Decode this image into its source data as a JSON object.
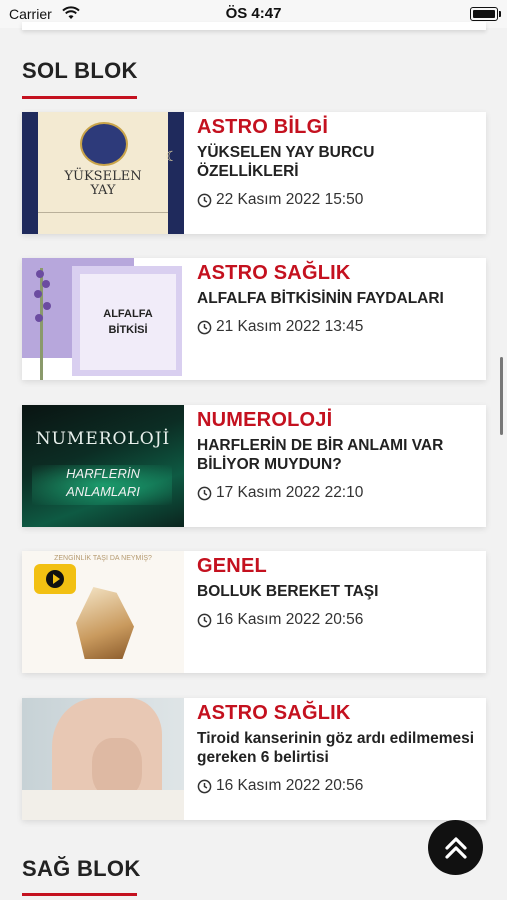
{
  "status_bar": {
    "carrier": "Carrier",
    "time": "ÖS 4:47"
  },
  "sections": {
    "left_title": "SOL BLOK",
    "right_title": "SAĞ BLOK",
    "accent_color": "#c4111f"
  },
  "articles": [
    {
      "category": "ASTRO BİLGİ",
      "title": "YÜKSELEN YAY BURCU ÖZELLİKLERİ",
      "date": "22 Kasım 2022 15:50",
      "thumb_text": [
        "YÜKSELEN",
        "YAY"
      ]
    },
    {
      "category": "ASTRO SAĞLIK",
      "title": "ALFALFA BİTKİSİNİN FAYDALARI",
      "date": "21 Kasım 2022 13:45",
      "thumb_text": [
        "ALFALFA",
        "BİTKİSİ"
      ]
    },
    {
      "category": "NUMEROLOJİ",
      "title": "HARFLERİN DE BİR ANLAMI VAR BİLİYOR MUYDUN?",
      "date": "17 Kasım 2022 22:10",
      "thumb_text": [
        "NUMEROLOJİ",
        "HARFLERİN",
        "ANLAMLARI"
      ]
    },
    {
      "category": "GENEL",
      "title": "BOLLUK BEREKET TAŞI",
      "date": "16 Kasım 2022 20:56",
      "thumb_text": [
        "ZENGİNLİK TAŞI DA NEYMİŞ?"
      ]
    },
    {
      "category": "ASTRO SAĞLIK",
      "title": "Tiroid kanserinin göz ardı edilmemesi gereken 6 belirtisi",
      "date": "16 Kasım 2022 20:56",
      "thumb_text": []
    }
  ],
  "icons": {
    "wifi": "wifi-icon",
    "battery": "battery-icon",
    "clock": "clock-icon",
    "scroll_top": "double-chevron-up-icon",
    "play": "play-icon"
  }
}
